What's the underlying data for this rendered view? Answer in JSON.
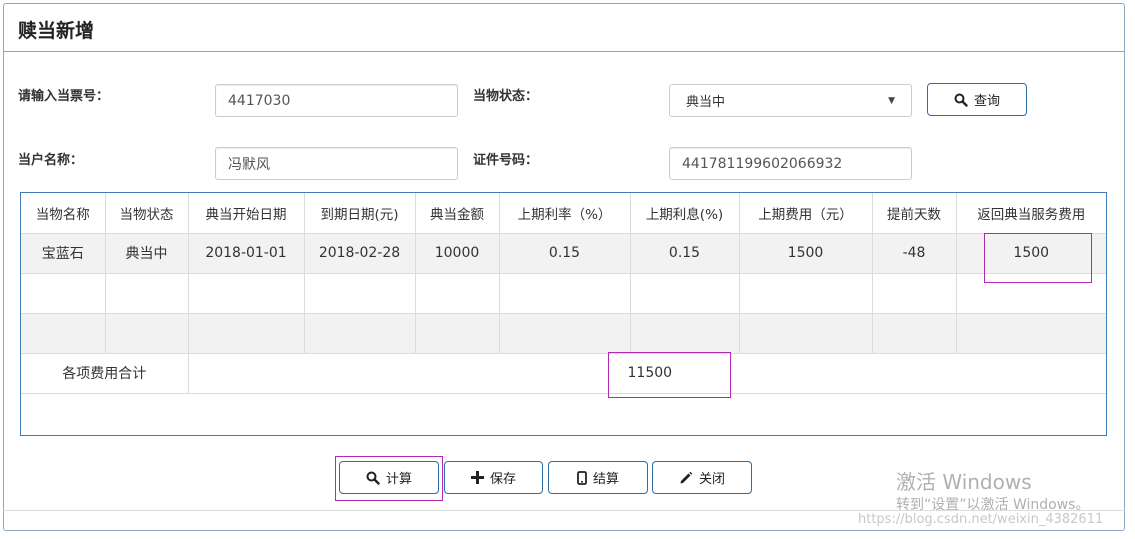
{
  "panel": {
    "title": "赎当新增"
  },
  "form": {
    "ticket_label": "请输入当票号：",
    "ticket_value": "4417030",
    "status_label": "当物状态：",
    "status_selected": "典当中",
    "query_label": "查询",
    "owner_label": "当户名称：",
    "owner_value": "冯默风",
    "id_label": "证件号码：",
    "id_value": "441781199602066932"
  },
  "table": {
    "headers": [
      "当物名称",
      "当物状态",
      "典当开始日期",
      "到期日期(元)",
      "典当金额",
      "上期利率（%）",
      "上期利息(%)",
      "上期费用（元）",
      "提前天数",
      "返回典当服务费用"
    ],
    "rows": [
      [
        "宝蓝石",
        "典当中",
        "2018-01-01",
        "2018-02-28",
        "10000",
        "0.15",
        "0.15",
        "1500",
        "-48",
        "1500"
      ]
    ],
    "total_label": "各项费用合计",
    "total_value": "11500"
  },
  "buttons": {
    "calc": "计算",
    "save": "保存",
    "settle": "结算",
    "close": "关闭"
  },
  "watermark": {
    "title": "激活 Windows",
    "subtitle": "转到“设置”以激活 Windows。",
    "url": "https://blog.csdn.net/weixin_4382611"
  },
  "colors": {
    "border": "#8aa7c4",
    "button_border": "#2e6da4",
    "highlight": "#b02ab5"
  }
}
